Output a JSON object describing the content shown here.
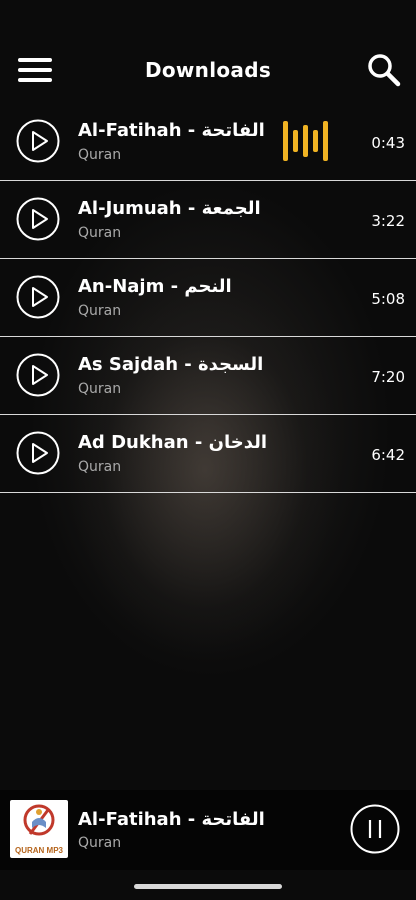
{
  "header": {
    "title": "Downloads"
  },
  "tracks": [
    {
      "title": "Al-Fatihah - الفاتحة",
      "subtitle": "Quran",
      "duration": "0:43",
      "playing": true
    },
    {
      "title": "Al-Jumuah - الجمعة",
      "subtitle": "Quran",
      "duration": "3:22"
    },
    {
      "title": "An-Najm - النحم",
      "subtitle": "Quran",
      "duration": "5:08"
    },
    {
      "title": "As Sajdah - السجدة",
      "subtitle": "Quran",
      "duration": "7:20"
    },
    {
      "title": "Ad Dukhan - الدخان",
      "subtitle": "Quran",
      "duration": "6:42"
    }
  ],
  "player": {
    "title": "Al-Fatihah - الفاتحة",
    "subtitle": "Quran",
    "art_label": "QURAN MP3"
  },
  "colors": {
    "accent": "#f0b323",
    "divider": "#d9d9d9",
    "subtitle": "#a9a9a9"
  },
  "icons": [
    "menu-icon",
    "search-icon",
    "play-icon",
    "equalizer-icon",
    "pause-icon"
  ]
}
